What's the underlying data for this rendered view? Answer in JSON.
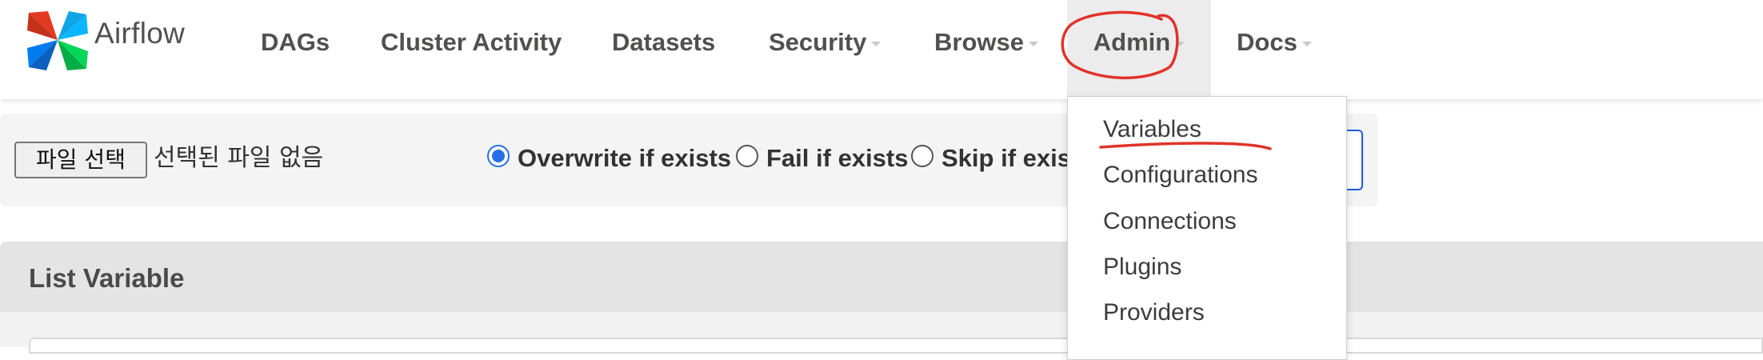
{
  "brand": {
    "name": "Airflow",
    "logo_icon": "airflow-pinwheel-icon"
  },
  "nav": {
    "items": [
      {
        "label": "DAGs",
        "has_caret": false
      },
      {
        "label": "Cluster Activity",
        "has_caret": false
      },
      {
        "label": "Datasets",
        "has_caret": false
      },
      {
        "label": "Security",
        "has_caret": true
      },
      {
        "label": "Browse",
        "has_caret": true
      },
      {
        "label": "Admin",
        "has_caret": true,
        "open": true
      },
      {
        "label": "Docs",
        "has_caret": true
      }
    ]
  },
  "import_form": {
    "file_button_label": "파일 선택",
    "file_status": "선택된 파일 없음",
    "options": [
      {
        "label": "Overwrite if exists",
        "checked": true
      },
      {
        "label": "Fail if exists",
        "checked": false
      },
      {
        "label": "Skip if exis",
        "checked": false
      }
    ]
  },
  "admin_menu": {
    "items": [
      {
        "label": "Variables"
      },
      {
        "label": "Configurations"
      },
      {
        "label": "Connections"
      },
      {
        "label": "Plugins"
      },
      {
        "label": "Providers"
      }
    ]
  },
  "list_panel": {
    "title": "List Variable"
  },
  "colors": {
    "text": "#51504f",
    "annotation_red": "#e0332a",
    "radio_blue": "#2a6ee6",
    "logo_red": "#e43921",
    "logo_blue": "#0cb6ff",
    "logo_green": "#00ad46",
    "logo_navy": "#017cee"
  }
}
